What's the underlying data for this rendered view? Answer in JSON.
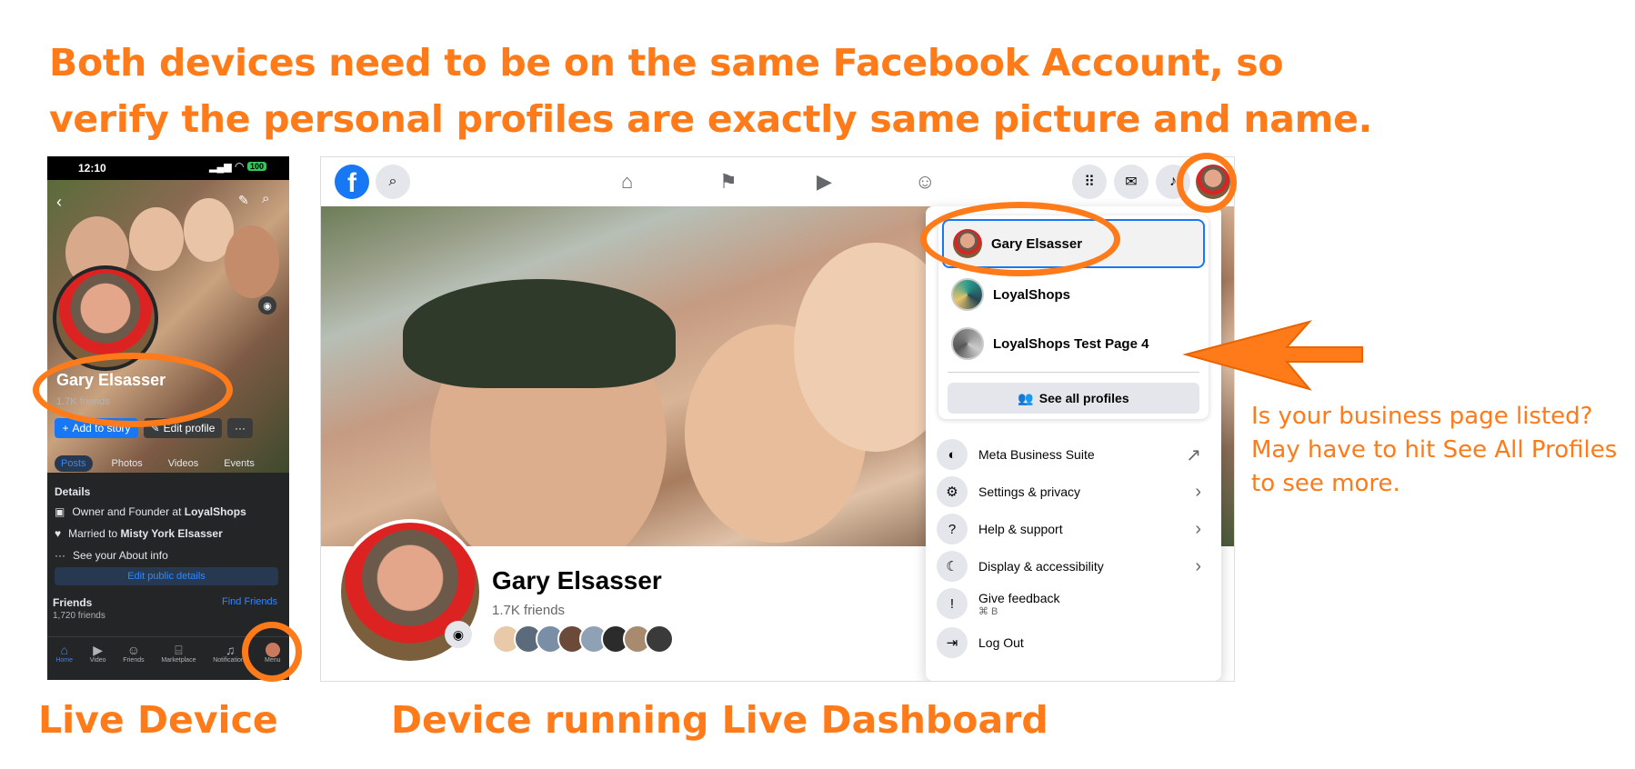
{
  "headline": {
    "line1": "Both devices need to be on the same Facebook Account, so",
    "line2": "verify the personal profiles are exactly same picture and name."
  },
  "captions": {
    "live_device": "Live Device",
    "dashboard": "Device running Live Dashboard"
  },
  "note": {
    "line1": "Is your business page listed?",
    "line2": "May have to hit See All Profiles",
    "line3": "to see more."
  },
  "accent_color": "#FF7A18",
  "phone": {
    "status": {
      "time": "12:10",
      "battery": "100"
    },
    "name": "Gary Elsasser",
    "friends": "1.7K friends",
    "add_story": "Add to story",
    "edit_profile": "Edit profile",
    "more": "···",
    "tabs": [
      "Posts",
      "Photos",
      "Videos",
      "Events"
    ],
    "details_title": "Details",
    "details": [
      {
        "icon": "briefcase-icon",
        "prefix": "Owner and Founder at ",
        "bold": "LoyalShops"
      },
      {
        "icon": "heart-icon",
        "prefix": "Married to ",
        "bold": "Misty York Elsasser"
      },
      {
        "icon": "dots-icon",
        "prefix": "See your About info",
        "bold": ""
      }
    ],
    "edit_public": "Edit public details",
    "friends_title": "Friends",
    "find_friends": "Find Friends",
    "friends_count": "1,720 friends",
    "nav": [
      "Home",
      "Video",
      "Friends",
      "Marketplace",
      "Notifications",
      "Menu"
    ]
  },
  "desktop": {
    "name": "Gary Elsasser",
    "friends": "1.7K friends",
    "profiles": [
      {
        "name": "Gary Elsasser"
      },
      {
        "name": "LoyalShops"
      },
      {
        "name": "LoyalShops Test Page 4"
      }
    ],
    "see_all": "See all profiles",
    "menu": [
      {
        "label": "Meta Business Suite",
        "sub": "",
        "icon": "meta-suite-icon",
        "arrow": "↗"
      },
      {
        "label": "Settings & privacy",
        "sub": "",
        "icon": "gear-icon",
        "arrow": "›"
      },
      {
        "label": "Help & support",
        "sub": "",
        "icon": "help-icon",
        "arrow": "›"
      },
      {
        "label": "Display & accessibility",
        "sub": "",
        "icon": "moon-icon",
        "arrow": "›"
      },
      {
        "label": "Give feedback",
        "sub": "⌘ B",
        "icon": "feedback-icon",
        "arrow": ""
      },
      {
        "label": "Log Out",
        "sub": "",
        "icon": "logout-icon",
        "arrow": ""
      }
    ]
  }
}
